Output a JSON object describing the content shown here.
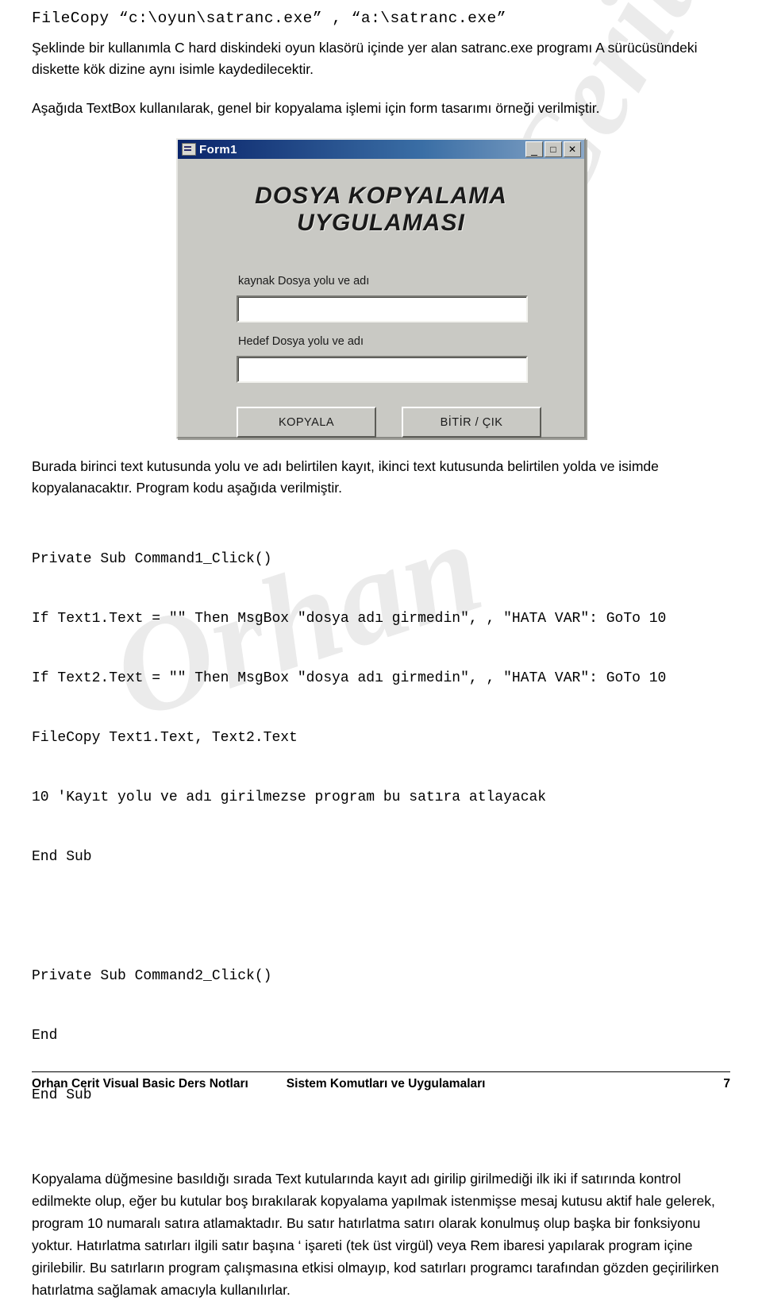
{
  "document": {
    "code_head": "FileCopy  “c:\\oyun\\satranc.exe” ,  “a:\\satranc.exe”",
    "para1": "Şeklinde bir kullanımla C hard diskindeki oyun klasörü içinde yer alan satranc.exe programı A sürücüsündeki diskette kök dizine aynı isimle kaydedilecektir.",
    "para2": "Aşağıda TextBox kullanılarak, genel bir kopyalama işlemi için form tasarımı örneği verilmiştir.",
    "para3": "Burada birinci text kutusunda yolu ve adı belirtilen kayıt, ikinci text kutusunda belirtilen yolda ve isimde kopyalanacaktır. Program kodu aşağıda verilmiştir.",
    "para4": "Kopyalama düğmesine basıldığı sırada Text kutularında kayıt adı girilip girilmediği ilk iki if satırında kontrol edilmekte olup, eğer bu kutular boş bırakılarak kopyalama yapılmak istenmişse mesaj kutusu aktif hale gelerek, program 10 numaralı satıra atlamaktadır. Bu satır hatırlatma satırı olarak konulmuş olup başka bir fonksiyonu yoktur. Hatırlatma satırları ilgili satır başına ‘ işareti (tek üst virgül) veya Rem ibaresi yapılarak program içine girilebilir. Bu satırların program çalışmasına etkisi olmayıp, kod satırları programcı tarafından gözden geçirilirken hatırlatma sağlamak amacıyla kullanılırlar."
  },
  "watermark": {
    "text1": "Cerit",
    "text2": "Orhan"
  },
  "vbform": {
    "title": "Form1",
    "icon": "form-window-icon",
    "minimize_label": "_",
    "maximize_label": "□",
    "close_label": "✕",
    "heading_line1": "DOSYA KOPYALAMA",
    "heading_line2": "UYGULAMASI",
    "label_source": "kaynak Dosya yolu ve adı",
    "label_target": "Hedef Dosya yolu ve adı",
    "textbox_source_value": "",
    "textbox_target_value": "",
    "button_copy": "KOPYALA",
    "button_exit": "BİTİR / ÇIK"
  },
  "code": {
    "lines": [
      "Private Sub Command1_Click()",
      "If Text1.Text = \"\" Then MsgBox \"dosya adı girmedin\", , \"HATA VAR\": GoTo 10",
      "If Text2.Text = \"\" Then MsgBox \"dosya adı girmedin\", , \"HATA VAR\": GoTo 10",
      "FileCopy Text1.Text, Text2.Text",
      "10 'Kayıt yolu ve adı girilmezse program bu satıra atlayacak",
      "End Sub"
    ],
    "lines2": [
      "Private Sub Command2_Click()",
      "End",
      "End Sub"
    ]
  },
  "footer": {
    "left": "Orhan Cerit Visual Basic Ders Notları",
    "middle": "Sistem Komutları ve Uygulamaları",
    "page": "7"
  }
}
